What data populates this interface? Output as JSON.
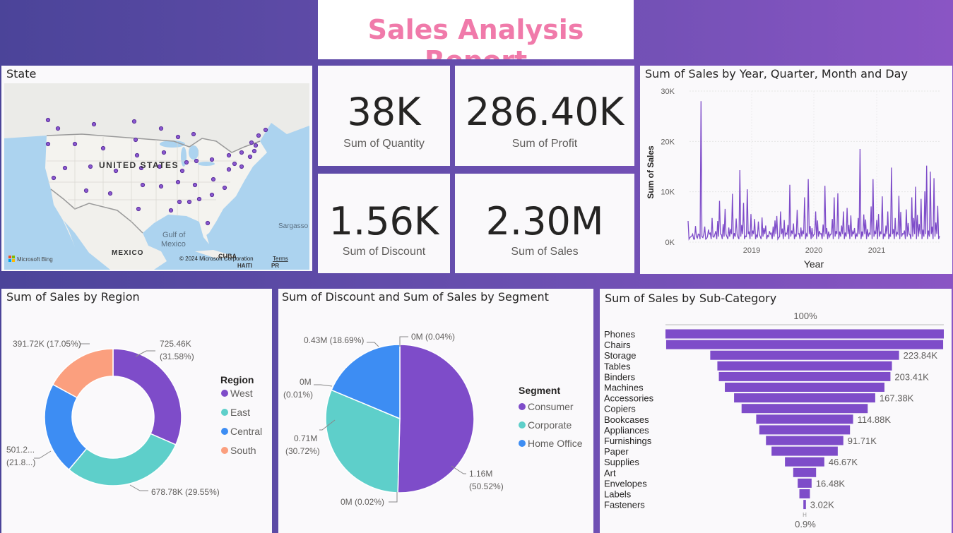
{
  "report_title": "Sales Analysis Report",
  "colors": {
    "accent_purple": "#7e4cc9",
    "teal": "#5ecfca",
    "blue": "#3d8df3",
    "salmon": "#fb9f7e",
    "title_pink": "#f07aaa"
  },
  "map": {
    "title": "State",
    "country_label": "UNITED STATES",
    "mexico_label": "MEXICO",
    "gulf_label_1": "Gulf of",
    "gulf_label_2": "Mexico",
    "cuba_label": "CUBA",
    "haiti_label": "HAITI",
    "pr_label": "PR",
    "sargasso_label": "Sargasso",
    "bing_label": "Microsoft Bing",
    "copyright": "© 2024 Microsoft Corporation",
    "terms": "Terms"
  },
  "kpis": {
    "quantity": {
      "value": "38K",
      "label": "Sum of Quantity"
    },
    "profit": {
      "value": "286.40K",
      "label": "Sum of Profit"
    },
    "discount": {
      "value": "1.56K",
      "label": "Sum of Discount"
    },
    "sales": {
      "value": "2.30M",
      "label": "Sum of Sales"
    }
  },
  "line_chart": {
    "title": "Sum of Sales by Year, Quarter, Month and Day",
    "ylabel": "Sum of Sales",
    "xlabel": "Year",
    "y_ticks": [
      "0K",
      "10K",
      "20K",
      "30K"
    ],
    "x_ticks": [
      "2019",
      "2020",
      "2021"
    ]
  },
  "region": {
    "title": "Sum of Sales by Region",
    "legend_title": "Region",
    "labels": {
      "west_1": "725.46K",
      "west_2": "(31.58%)",
      "east": "678.78K (29.55%)",
      "central_1": "501.2...",
      "central_2": "(21.8...)",
      "south": "391.72K (17.05%)"
    }
  },
  "segment": {
    "title": "Sum of Discount and Sum of Sales by Segment",
    "legend_title": "Segment",
    "labels": {
      "top_right": "0M (0.04%)",
      "consumer_1": "1.16M",
      "consumer_2": "(50.52%)",
      "bottom": "0M (0.02%)",
      "corporate_1": "0.71M",
      "corporate_2": "(30.72%)",
      "left_small_1": "0M",
      "left_small_2": "(0.01%)",
      "home_office": "0.43M (18.69%)"
    }
  },
  "subcat": {
    "title": "Sum of Sales by Sub-Category",
    "top_pct": "100%",
    "bottom_pct": "0.9%",
    "h_marker": "H",
    "value_labels": {
      "storage": "223.84K",
      "binders": "203.41K",
      "accessories": "167.38K",
      "bookcases": "114.88K",
      "furnishings": "91.71K",
      "supplies": "46.67K",
      "envelopes": "16.48K",
      "fasteners": "3.02K"
    }
  },
  "chart_data": [
    {
      "type": "line",
      "title": "Sum of Sales by Year, Quarter, Month and Day",
      "xlabel": "Year",
      "ylabel": "Sum of Sales",
      "x_ticks": [
        "2019",
        "2020",
        "2021"
      ],
      "ylim": [
        0,
        30000
      ],
      "series": [
        {
          "values": [
            4200,
            900,
            1200,
            600,
            3200,
            800,
            1500,
            28000,
            900,
            3100,
            700,
            2500,
            1800,
            4800,
            1000,
            2200,
            4200,
            8200,
            1500,
            3600,
            6600,
            1100,
            2900,
            2600,
            9600,
            1800,
            4700,
            1000,
            14300,
            3400,
            7800,
            1200,
            10500,
            2100,
            5600,
            2300,
            4600,
            1400,
            4100,
            1100,
            4900,
            2800,
            3300,
            1300,
            2200,
            1800,
            3100,
            4300,
            5200,
            900,
            6100,
            2700,
            4400,
            1800,
            3400,
            11400,
            2300,
            3700,
            1500,
            6400,
            1700,
            2900,
            2300,
            8900,
            1600,
            12500,
            3200,
            2800,
            1500,
            6100,
            4300,
            2200,
            1700,
            3500,
            11200,
            2800,
            2100,
            1600,
            4600,
            8900,
            2200,
            9700,
            2100,
            3300,
            6100,
            1900,
            6800,
            3400,
            5300,
            2100,
            2800,
            1600,
            4800,
            18500,
            2100,
            5500,
            4500,
            2600,
            1800,
            7100,
            12500,
            2100,
            4400,
            5600,
            2000,
            9100,
            1700,
            3300,
            6100,
            1500,
            14800,
            2600,
            4800,
            1900,
            9200,
            6000,
            1700,
            2300,
            6500,
            3800,
            1500,
            8900,
            4800,
            11000,
            5400,
            3600,
            8600,
            2500,
            10100,
            15200,
            2300,
            14000,
            3100,
            12700,
            3900,
            7200,
            1200
          ]
        }
      ]
    },
    {
      "type": "pie",
      "subtype": "donut",
      "title": "Sum of Sales by Region",
      "legend_title": "Region",
      "categories": [
        "West",
        "East",
        "Central",
        "South"
      ],
      "values": [
        725.46,
        678.78,
        501.24,
        391.72
      ],
      "percent": [
        31.58,
        29.55,
        21.82,
        17.05
      ],
      "unit": "K",
      "colors": [
        "#7e4cc9",
        "#5ecfca",
        "#3d8df3",
        "#fb9f7e"
      ]
    },
    {
      "type": "pie",
      "title": "Sum of Discount and Sum of Sales by Segment",
      "legend_title": "Segment",
      "categories": [
        "Consumer",
        "Corporate",
        "Home Office"
      ],
      "series": [
        {
          "name": "Sum of Sales",
          "values": [
            1.16,
            0.71,
            0.43
          ],
          "percent": [
            50.52,
            30.72,
            18.69
          ],
          "unit": "M"
        },
        {
          "name": "Sum of Discount",
          "values": [
            0,
            0,
            0
          ],
          "percent": [
            0.04,
            0.02,
            0.01
          ],
          "unit": "M"
        }
      ],
      "colors": [
        "#7e4cc9",
        "#5ecfca",
        "#3d8df3"
      ]
    },
    {
      "type": "bar",
      "subtype": "funnel",
      "title": "Sum of Sales by Sub-Category",
      "categories": [
        "Phones",
        "Chairs",
        "Storage",
        "Tables",
        "Binders",
        "Machines",
        "Accessories",
        "Copiers",
        "Bookcases",
        "Appliances",
        "Furnishings",
        "Paper",
        "Supplies",
        "Art",
        "Envelopes",
        "Labels",
        "Fasteners"
      ],
      "values": [
        330.0,
        328.4,
        223.84,
        206.97,
        203.41,
        189.24,
        167.38,
        149.53,
        114.88,
        107.53,
        91.71,
        78.48,
        46.67,
        27.12,
        16.48,
        12.49,
        3.02
      ],
      "unit": "K",
      "top_pct": "100%",
      "bottom_pct": "0.9%"
    }
  ]
}
